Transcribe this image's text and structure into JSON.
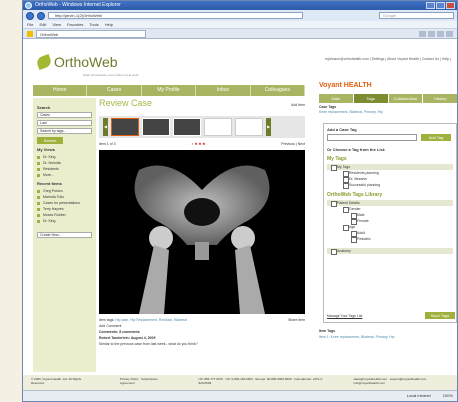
{
  "browser": {
    "title": "OrthoWeb - Windows Internet Explorer",
    "url": "http://jarvin-1(2)OrthoWeb/",
    "search_placeholder": "Google",
    "menu": [
      "File",
      "Edit",
      "View",
      "Favorites",
      "Tools",
      "Help"
    ],
    "tab_label": "OrthoWeb",
    "status_zone": "Local intranet",
    "zoom": "100%"
  },
  "site": {
    "logo": "OrthoWeb",
    "tagline": "Work productively, even when not at work",
    "userbar": "mjohnson@orthohealth.com | Settings | About Voyant Health | Contact Us | Help |",
    "nav": [
      "Home",
      "Cases",
      "My Profile",
      "Inbox",
      "Colleagues"
    ]
  },
  "sidebar": {
    "search_heading": "Search",
    "select1": "Cases",
    "select2": "Last",
    "search_tags": "Search by tags...",
    "search_button": "Search",
    "views_heading": "My Views",
    "views": [
      "Dr. King",
      "Dr. Nohotta",
      "Residents",
      "More..."
    ],
    "recent_heading": "Recent Items",
    "recent": [
      "Greg Poston",
      "Marinda Tulio",
      "Cases for presentations",
      "Terry Haynes",
      "Moses Robber",
      "Dr. King"
    ],
    "create": "Create New..."
  },
  "content": {
    "title": "Review Case",
    "add_item": "Add Item",
    "item_count": "Item 1 of 3",
    "prev": "Previous",
    "next": "Next",
    "item_tags_label": "Item tags:",
    "item_tags": "Hip pain, Hip Replacement, Revision, Bilateral",
    "share": "Share item",
    "add_comment": "Add Comment",
    "comments": "Comments: 8 comments",
    "comment_author": "Robert Tanderlein: August 4, 2009",
    "comment_text": "Similar to the previous case from last week...what do you think?"
  },
  "right_panel": {
    "brand": "Voyant HEALTH",
    "tabs": [
      "Main",
      "Tags",
      "Collaboration",
      "History"
    ],
    "case_tags_label": "Case Tags",
    "case_tags": "Knee replacement, Bilateral, Primary, Hip",
    "add_heading": "Add a Case Tag",
    "add_button": "Add Tag",
    "choose": "Or Choose a Tag from the List:",
    "my_tags": "My Tags",
    "my_tags_items": [
      "My Tags",
      "Residents planning",
      "Dr. Bezanis",
      "Successful planning"
    ],
    "library": "OrthoWeb Tags Library",
    "library_items": [
      "Patient Details",
      "Gender",
      "Male",
      "Female",
      "Age",
      "Adult",
      "Pediatric",
      "Anatomy"
    ],
    "manage": "Manage Your Tags List",
    "save": "Save Tags",
    "item_tags_label": "Item Tags",
    "item_tags": "Item 1: Knee replacement, Bilateral, Primary, Hip"
  },
  "footer": {
    "copy": "© 2009, Voyant Health, Ltd. All Rights Reserved.",
    "links": "Privacy Policy · Subscription Agreement",
    "phones": "US: 866-777-0070 · UK: 0-800-404-0604 · Europe: 00-800-5000-5000 · International: +972-3-920-0509",
    "emails": "sales@voyanthealth.com · support@voyanthealth.com · info@voyanthealth.com"
  },
  "colors": {
    "brand_green": "#a9b563",
    "accent_orange": "#e06010"
  }
}
